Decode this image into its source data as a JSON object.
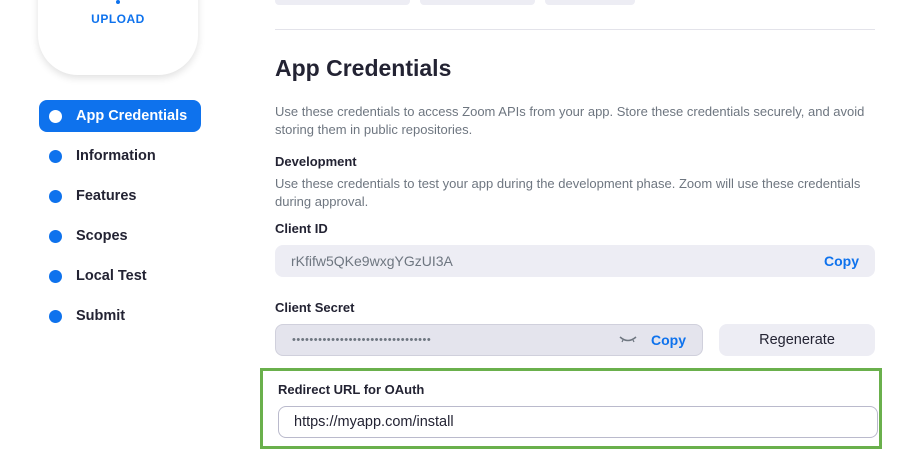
{
  "upload": {
    "label": "UPLOAD"
  },
  "sidebar": {
    "items": [
      {
        "label": "App Credentials",
        "active": true
      },
      {
        "label": "Information",
        "active": false
      },
      {
        "label": "Features",
        "active": false
      },
      {
        "label": "Scopes",
        "active": false
      },
      {
        "label": "Local Test",
        "active": false
      },
      {
        "label": "Submit",
        "active": false
      }
    ]
  },
  "main": {
    "title": "App Credentials",
    "description": "Use these credentials to access Zoom APIs from your app. Store these credentials securely, and avoid storing them in public repositories.",
    "development": {
      "heading": "Development",
      "description": "Use these credentials to test your app during the development phase. Zoom will use these credentials during approval."
    },
    "client_id": {
      "label": "Client ID",
      "value": "rKfifw5QKe9wxgYGzUI3A",
      "copy_label": "Copy"
    },
    "client_secret": {
      "label": "Client Secret",
      "value": "••••••••••••••••••••••••••••••••",
      "copy_label": "Copy",
      "regenerate_label": "Regenerate",
      "eye_icon": "eye-closed-icon"
    },
    "redirect": {
      "label": "Redirect URL for OAuth",
      "value": "https://myapp.com/install"
    }
  },
  "colors": {
    "accent": "#0e72ed",
    "highlight": "#6ab04c",
    "field_bg": "#ededf4"
  }
}
